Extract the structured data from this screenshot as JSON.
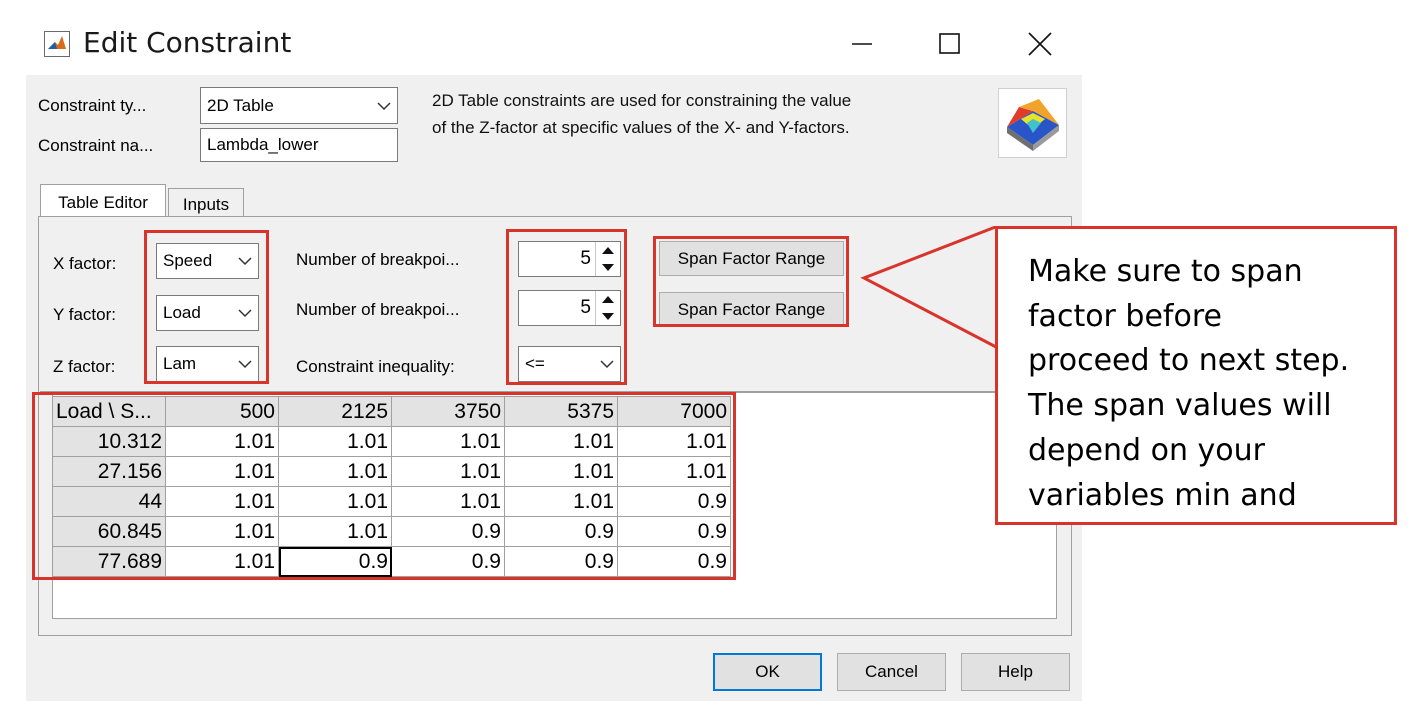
{
  "window": {
    "title": "Edit Constraint",
    "app_icon": "matlab-icon",
    "controls": [
      "minimize-icon",
      "maximize-icon",
      "close-icon"
    ]
  },
  "header": {
    "type_label": "Constraint ty...",
    "type_value": "2D Table",
    "name_label": "Constraint na...",
    "name_value": "Lambda_lower",
    "description_line1": "2D Table constraints are used for constraining the value",
    "description_line2": "of the Z-factor at specific values of the X- and Y-factors.",
    "preview_icon": "surface-plot-icon"
  },
  "tabs": [
    {
      "label": "Table Editor",
      "active": true
    },
    {
      "label": "Inputs",
      "active": false
    }
  ],
  "factors": {
    "x_label": "X factor:",
    "x_value": "Speed",
    "y_label": "Y factor:",
    "y_value": "Load",
    "z_label": "Z factor:",
    "z_value": "Lam"
  },
  "breakpoints": {
    "x_label": "Number of breakpoi...",
    "x_value": "5",
    "y_label": "Number of breakpoi...",
    "y_value": "5",
    "inequality_label": "Constraint inequality:",
    "inequality_value": "<="
  },
  "span_buttons": {
    "x_label": "Span Factor Range",
    "y_label": "Span Factor Range"
  },
  "table": {
    "corner": "Load \\ S...",
    "columns": [
      "500",
      "2125",
      "3750",
      "5375",
      "7000"
    ],
    "rows": [
      {
        "label": "10.312",
        "values": [
          "1.01",
          "1.01",
          "1.01",
          "1.01",
          "1.01"
        ]
      },
      {
        "label": "27.156",
        "values": [
          "1.01",
          "1.01",
          "1.01",
          "1.01",
          "1.01"
        ]
      },
      {
        "label": "44",
        "values": [
          "1.01",
          "1.01",
          "1.01",
          "1.01",
          "0.9"
        ]
      },
      {
        "label": "60.845",
        "values": [
          "1.01",
          "1.01",
          "0.9",
          "0.9",
          "0.9"
        ]
      },
      {
        "label": "77.689",
        "values": [
          "1.01",
          "0.9",
          "0.9",
          "0.9",
          "0.9"
        ]
      }
    ]
  },
  "footer": {
    "ok_label": "OK",
    "cancel_label": "Cancel",
    "help_label": "Help"
  },
  "annotation": {
    "lines": [
      "Make sure to span",
      "factor before",
      "proceed to next step.",
      "The span values will",
      "depend on your",
      "variables min and"
    ],
    "highlight_color": "#d9342b"
  }
}
